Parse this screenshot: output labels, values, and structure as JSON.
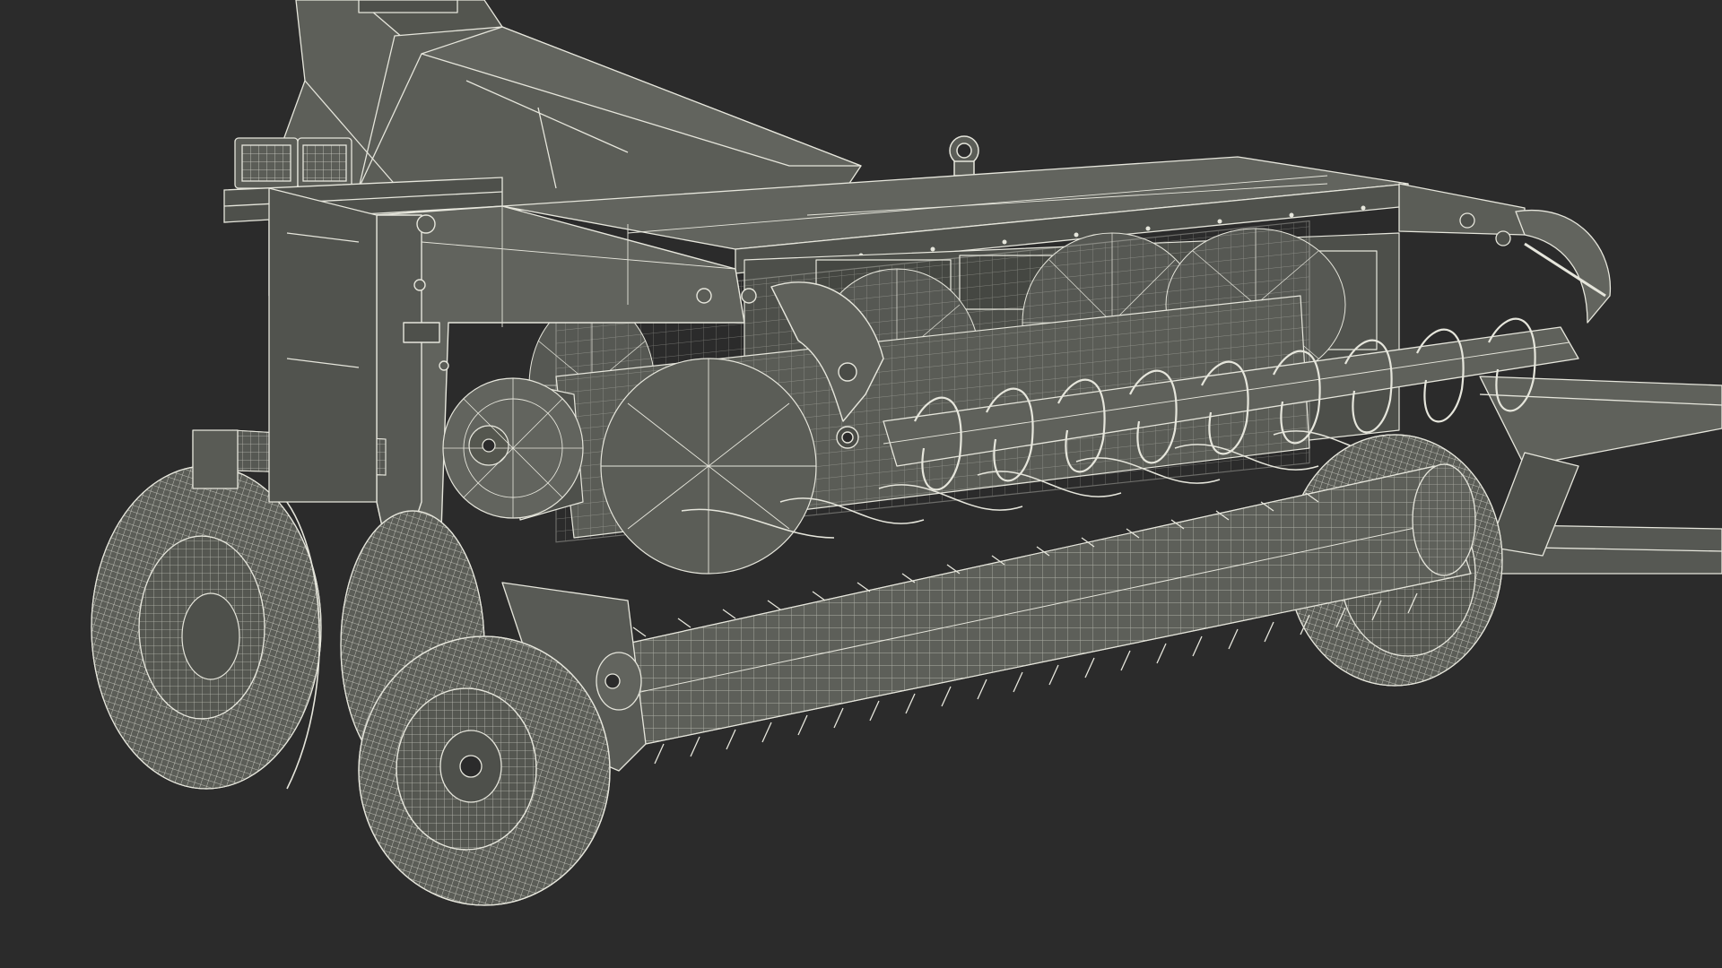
{
  "scene": {
    "background_color": "#2b2b2b",
    "body_fill_color": "#5b5d57",
    "body_shade_color": "#4a4c47",
    "body_light_color": "#6a6c66",
    "wire_color": "#e6e6dc",
    "wire_dim_color": "#c9c9bf"
  }
}
